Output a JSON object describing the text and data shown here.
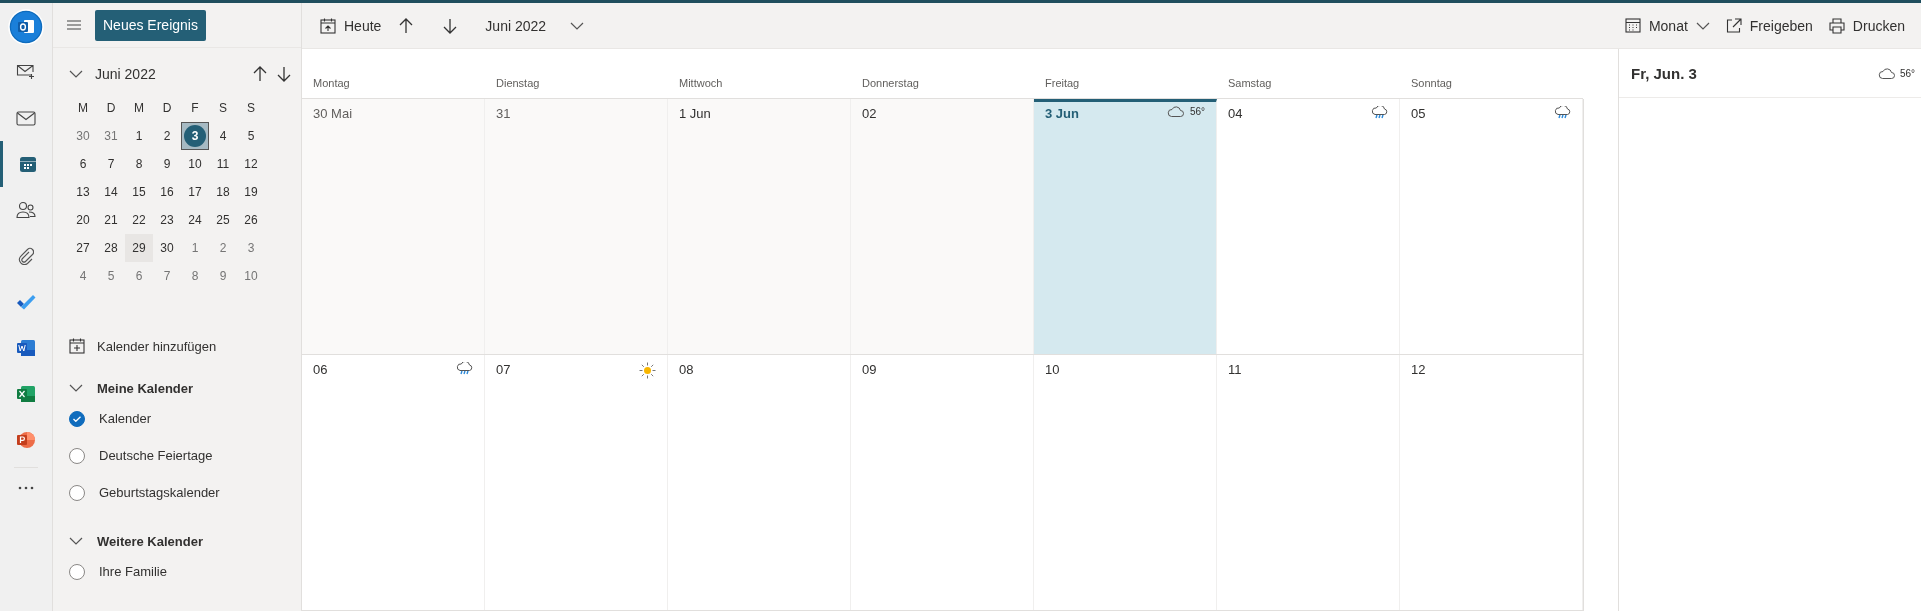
{
  "rail": [
    {
      "kind": "logo",
      "selected": false
    },
    {
      "kind": "new-mail",
      "selected": false
    },
    {
      "kind": "mail",
      "selected": false
    },
    {
      "kind": "calendar",
      "selected": true
    },
    {
      "kind": "people",
      "selected": false
    },
    {
      "kind": "files",
      "selected": false
    },
    {
      "kind": "todo",
      "selected": false
    },
    {
      "kind": "word",
      "selected": false
    },
    {
      "kind": "excel",
      "selected": false
    },
    {
      "kind": "powerpoint",
      "selected": false
    },
    {
      "kind": "more",
      "selected": false
    }
  ],
  "new_event_button": "Neues Ereignis",
  "mini_calendar": {
    "title": "Juni 2022",
    "weekdays": [
      "M",
      "D",
      "M",
      "D",
      "F",
      "S",
      "S"
    ],
    "days": [
      {
        "label": "30",
        "other_month": true,
        "selected": false,
        "hovered": false
      },
      {
        "label": "31",
        "other_month": true,
        "selected": false,
        "hovered": false
      },
      {
        "label": "1",
        "other_month": false,
        "selected": false,
        "hovered": false
      },
      {
        "label": "2",
        "other_month": false,
        "selected": false,
        "hovered": false
      },
      {
        "label": "3",
        "other_month": false,
        "selected": true,
        "hovered": false
      },
      {
        "label": "4",
        "other_month": false,
        "selected": false,
        "hovered": false
      },
      {
        "label": "5",
        "other_month": false,
        "selected": false,
        "hovered": false
      },
      {
        "label": "6",
        "other_month": false,
        "selected": false,
        "hovered": false
      },
      {
        "label": "7",
        "other_month": false,
        "selected": false,
        "hovered": false
      },
      {
        "label": "8",
        "other_month": false,
        "selected": false,
        "hovered": false
      },
      {
        "label": "9",
        "other_month": false,
        "selected": false,
        "hovered": false
      },
      {
        "label": "10",
        "other_month": false,
        "selected": false,
        "hovered": false
      },
      {
        "label": "11",
        "other_month": false,
        "selected": false,
        "hovered": false
      },
      {
        "label": "12",
        "other_month": false,
        "selected": false,
        "hovered": false
      },
      {
        "label": "13",
        "other_month": false,
        "selected": false,
        "hovered": false
      },
      {
        "label": "14",
        "other_month": false,
        "selected": false,
        "hovered": false
      },
      {
        "label": "15",
        "other_month": false,
        "selected": false,
        "hovered": false
      },
      {
        "label": "16",
        "other_month": false,
        "selected": false,
        "hovered": false
      },
      {
        "label": "17",
        "other_month": false,
        "selected": false,
        "hovered": false
      },
      {
        "label": "18",
        "other_month": false,
        "selected": false,
        "hovered": false
      },
      {
        "label": "19",
        "other_month": false,
        "selected": false,
        "hovered": false
      },
      {
        "label": "20",
        "other_month": false,
        "selected": false,
        "hovered": false
      },
      {
        "label": "21",
        "other_month": false,
        "selected": false,
        "hovered": false
      },
      {
        "label": "22",
        "other_month": false,
        "selected": false,
        "hovered": false
      },
      {
        "label": "23",
        "other_month": false,
        "selected": false,
        "hovered": false
      },
      {
        "label": "24",
        "other_month": false,
        "selected": false,
        "hovered": false
      },
      {
        "label": "25",
        "other_month": false,
        "selected": false,
        "hovered": false
      },
      {
        "label": "26",
        "other_month": false,
        "selected": false,
        "hovered": false
      },
      {
        "label": "27",
        "other_month": false,
        "selected": false,
        "hovered": false
      },
      {
        "label": "28",
        "other_month": false,
        "selected": false,
        "hovered": false
      },
      {
        "label": "29",
        "other_month": false,
        "selected": false,
        "hovered": true
      },
      {
        "label": "30",
        "other_month": false,
        "selected": false,
        "hovered": false
      },
      {
        "label": "1",
        "other_month": true,
        "selected": false,
        "hovered": false
      },
      {
        "label": "2",
        "other_month": true,
        "selected": false,
        "hovered": false
      },
      {
        "label": "3",
        "other_month": true,
        "selected": false,
        "hovered": false
      },
      {
        "label": "4",
        "other_month": true,
        "selected": false,
        "hovered": false
      },
      {
        "label": "5",
        "other_month": true,
        "selected": false,
        "hovered": false
      },
      {
        "label": "6",
        "other_month": true,
        "selected": false,
        "hovered": false
      },
      {
        "label": "7",
        "other_month": true,
        "selected": false,
        "hovered": false
      },
      {
        "label": "8",
        "other_month": true,
        "selected": false,
        "hovered": false
      },
      {
        "label": "9",
        "other_month": true,
        "selected": false,
        "hovered": false
      },
      {
        "label": "10",
        "other_month": true,
        "selected": false,
        "hovered": false
      }
    ]
  },
  "add_calendar": "Kalender hinzufügen",
  "calendar_groups": [
    {
      "title": "Meine Kalender",
      "expanded": true,
      "items": [
        {
          "label": "Kalender",
          "checked": true
        },
        {
          "label": "Deutsche Feiertage",
          "checked": false
        },
        {
          "label": "Geburtstagskalender",
          "checked": false
        }
      ]
    },
    {
      "title": "Weitere Kalender",
      "expanded": true,
      "items": [
        {
          "label": "Ihre Familie",
          "checked": false
        }
      ]
    }
  ],
  "toolbar": {
    "today": "Heute",
    "period": "Juni 2022",
    "view": "Monat",
    "share": "Freigeben",
    "print": "Drucken"
  },
  "weekday_headers": [
    "Montag",
    "Dienstag",
    "Mittwoch",
    "Donnerstag",
    "Freitag",
    "Samstag",
    "Sonntag"
  ],
  "weeks": [
    [
      {
        "label": "30 Mai",
        "kind": "past",
        "other_month": true
      },
      {
        "label": "31",
        "kind": "past",
        "other_month": true
      },
      {
        "label": "1 Jun",
        "kind": "past",
        "other_month": false
      },
      {
        "label": "02",
        "kind": "past",
        "other_month": false
      },
      {
        "label": "3 Jun",
        "kind": "today",
        "other_month": false,
        "forecast": {
          "kind": "cloud",
          "temperature": "56°"
        }
      },
      {
        "label": "04",
        "kind": "future",
        "other_month": false,
        "forecast": {
          "kind": "rain"
        }
      },
      {
        "label": "05",
        "kind": "future",
        "other_month": false,
        "forecast": {
          "kind": "rain"
        }
      }
    ],
    [
      {
        "label": "06",
        "kind": "future",
        "other_month": false,
        "forecast": {
          "kind": "rain"
        }
      },
      {
        "label": "07",
        "kind": "future",
        "other_month": false,
        "forecast": {
          "kind": "sun"
        }
      },
      {
        "label": "08",
        "kind": "future",
        "other_month": false
      },
      {
        "label": "09",
        "kind": "future",
        "other_month": false
      },
      {
        "label": "10",
        "kind": "future",
        "other_month": false
      },
      {
        "label": "11",
        "kind": "future",
        "other_month": false
      },
      {
        "label": "12",
        "kind": "future",
        "other_month": false
      }
    ]
  ],
  "day_pane": {
    "title": "Fr, Jun. 3",
    "forecast": {
      "kind": "cloud",
      "temperature": "56°"
    }
  }
}
